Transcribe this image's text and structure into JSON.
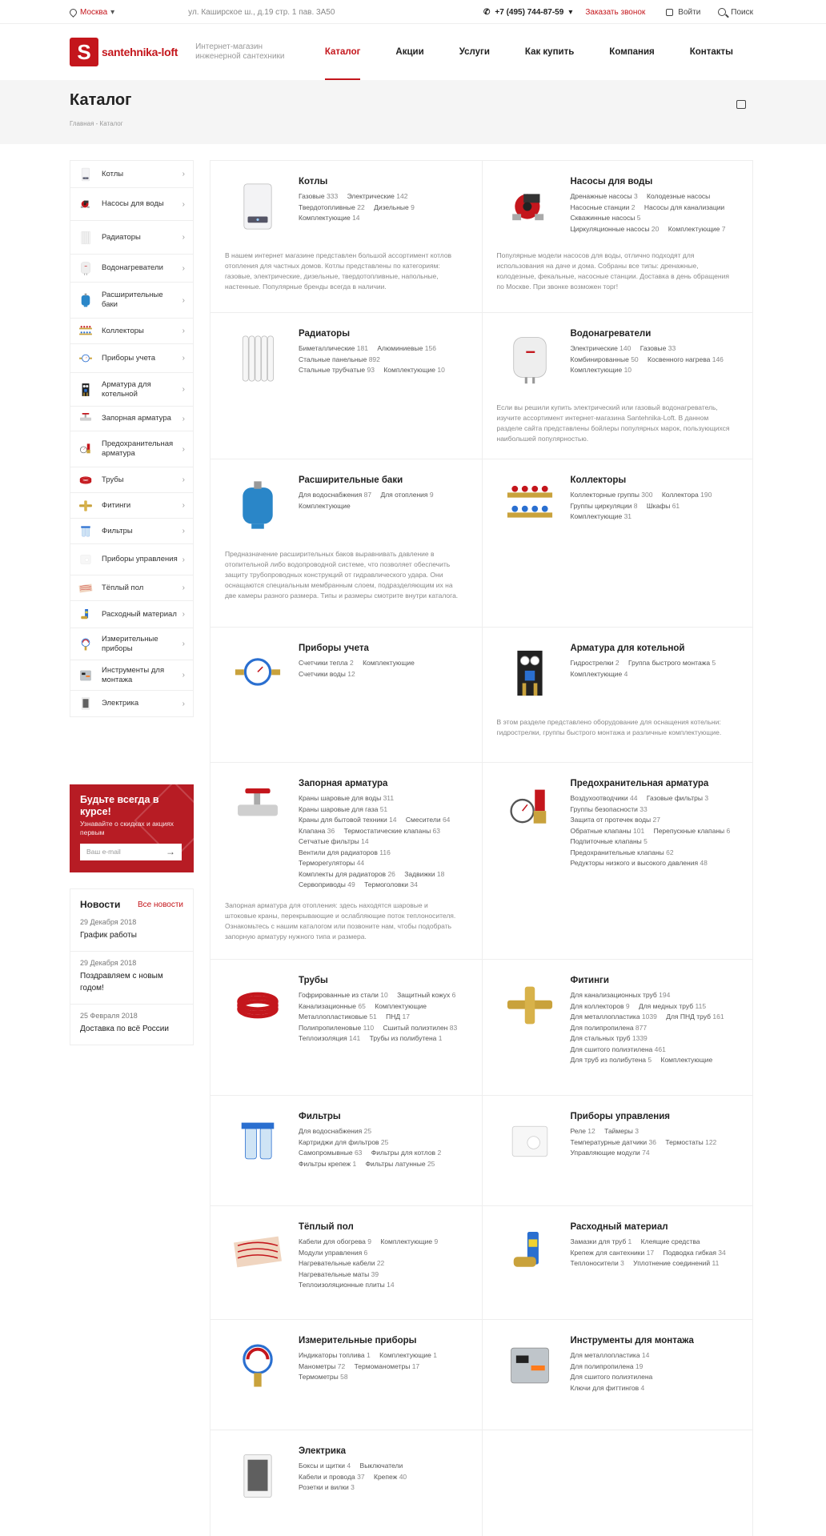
{
  "topbar": {
    "city": "Москва",
    "address": "ул. Каширское ш., д.19 стр. 1 пав. 3А50",
    "phone": "+7 (495) 744-87-59",
    "callback": "Заказать звонок",
    "login": "Войти",
    "search": "Поиск"
  },
  "header": {
    "logo_letter": "S",
    "logo_text": "santehnika-loft",
    "tagline": "Интернет-магазин инженерной сантехники",
    "nav": [
      "Каталог",
      "Акции",
      "Услуги",
      "Как купить",
      "Компания",
      "Контакты"
    ]
  },
  "page": {
    "title": "Каталог",
    "breadcrumb": "Главная - Каталог"
  },
  "sidebar": [
    {
      "label": "Котлы",
      "icon": "boiler-icon"
    },
    {
      "label": "Насосы для воды",
      "icon": "pump-icon"
    },
    {
      "label": "Радиаторы",
      "icon": "radiator-icon"
    },
    {
      "label": "Водонагреватели",
      "icon": "water-heater-icon"
    },
    {
      "label": "Расширительные баки",
      "icon": "expansion-tank-icon"
    },
    {
      "label": "Коллекторы",
      "icon": "manifold-icon"
    },
    {
      "label": "Приборы учета",
      "icon": "water-meter-icon"
    },
    {
      "label": "Арматура для котельной",
      "icon": "boiler-fitting-icon"
    },
    {
      "label": "Запорная арматура",
      "icon": "valve-icon"
    },
    {
      "label": "Предохранительная арматура",
      "icon": "safety-valve-icon"
    },
    {
      "label": "Трубы",
      "icon": "pipe-icon"
    },
    {
      "label": "Фитинги",
      "icon": "fitting-icon"
    },
    {
      "label": "Фильтры",
      "icon": "filter-icon"
    },
    {
      "label": "Приборы управления",
      "icon": "thermostat-icon"
    },
    {
      "label": "Тёплый пол",
      "icon": "floor-heating-icon"
    },
    {
      "label": "Расходный материал",
      "icon": "consumables-icon"
    },
    {
      "label": "Измерительные приборы",
      "icon": "gauge-icon"
    },
    {
      "label": "Инструменты для монтажа",
      "icon": "toolkit-icon"
    },
    {
      "label": "Электрика",
      "icon": "electrical-box-icon"
    }
  ],
  "subscribe": {
    "title": "Будьте всегда в курсе!",
    "text": "Узнавайте о скидках и акциях первым",
    "placeholder": "Ваш e-mail"
  },
  "news": {
    "title": "Новости",
    "all": "Все новости",
    "items": [
      {
        "date": "29 Декабря 2018",
        "title": "График работы"
      },
      {
        "date": "29 Декабря 2018",
        "title": "Поздравляем с новым годом!"
      },
      {
        "date": "25 Февраля 2018",
        "title": "Доставка по всё России"
      }
    ]
  },
  "catalog": [
    {
      "title": "Котлы",
      "icon": "boiler-icon",
      "subs": [
        [
          "Газовые",
          "333"
        ],
        [
          "Электрические",
          "142"
        ],
        [
          "Твердотопливные",
          "22"
        ],
        [
          "Дизельные",
          "9"
        ],
        [
          "Комплектующие",
          "14"
        ]
      ],
      "desc": "В нашем интернет магазине представлен большой ассортимент котлов отопления для частных домов. Котлы представлены по категориям: газовые, электрические, дизельные, твердотопливные, напольные, настенные. Популярные бренды всегда в наличии."
    },
    {
      "title": "Насосы для воды",
      "icon": "pump-icon",
      "subs": [
        [
          "Дренажные насосы",
          "3"
        ],
        [
          "Колодезные насосы",
          ""
        ],
        [
          "Насосные станции",
          "2"
        ],
        [
          "Насосы для канализации",
          ""
        ],
        [
          "Скважинные насосы",
          "5"
        ],
        [
          "Циркуляционные насосы",
          "20"
        ],
        [
          "Комплектующие",
          "7"
        ]
      ],
      "desc": "Популярные модели насосов для воды, отлично подходят для использования на даче и дома. Собраны все типы: дренажные, колодезные, фекальные, насосные станции. Доставка в день обращения по Москве. При звонке возможен торг!"
    },
    {
      "title": "Радиаторы",
      "icon": "radiator-icon",
      "subs": [
        [
          "Биметаллические",
          "181"
        ],
        [
          "Алюминиевые",
          "156"
        ],
        [
          "Стальные панельные",
          "892"
        ],
        [
          "Стальные трубчатые",
          "93"
        ],
        [
          "Комплектующие",
          "10"
        ]
      ],
      "desc": ""
    },
    {
      "title": "Водонагреватели",
      "icon": "water-heater-icon",
      "subs": [
        [
          "Электрические",
          "140"
        ],
        [
          "Газовые",
          "33"
        ],
        [
          "Комбинированные",
          "50"
        ],
        [
          "Косвенного нагрева",
          "146"
        ],
        [
          "Комплектующие",
          "10"
        ]
      ],
      "desc": "Если вы решили купить электрический или газовый водонагреватель, изучите ассортимент интернет-магазина Santehnika-Loft. В данном разделе сайта представлены бойлеры популярных марок, пользующихся наибольшей популярностью."
    },
    {
      "title": "Расширительные баки",
      "icon": "expansion-tank-icon",
      "subs": [
        [
          "Для водоснабжения",
          "87"
        ],
        [
          "Для отопления",
          "9"
        ],
        [
          "Комплектующие",
          ""
        ]
      ],
      "desc": "Предназначение расширительных баков выравнивать давление в отопительной либо водопроводной системе, что позволяет обеспечить защиту трубопроводных конструкций от гидравлического удара. Они оснащаются специальным мембранным слоем, подразделяющим их на две камеры разного размера. Типы и размеры смотрите внутри каталога."
    },
    {
      "title": "Коллекторы",
      "icon": "manifold-icon",
      "subs": [
        [
          "Коллекторные группы",
          "300"
        ],
        [
          "Коллектора",
          "190"
        ],
        [
          "Группы циркуляции",
          "8"
        ],
        [
          "Шкафы",
          "61"
        ],
        [
          "Комплектующие",
          "31"
        ]
      ],
      "desc": ""
    },
    {
      "title": "Приборы учета",
      "icon": "water-meter-icon",
      "subs": [
        [
          "Счетчики тепла",
          "2"
        ],
        [
          "Комплектующие",
          ""
        ],
        [
          "Счетчики воды",
          "12"
        ]
      ],
      "desc": ""
    },
    {
      "title": "Арматура для котельной",
      "icon": "boiler-fitting-icon",
      "subs": [
        [
          "Гидрострелки",
          "2"
        ],
        [
          "Группа быстрого монтажа",
          "5"
        ],
        [
          "Комплектующие",
          "4"
        ]
      ],
      "desc": "В этом разделе представлено оборудование для оснащения котельни: гидрострелки, группы быстрого монтажа и различные комплектующие."
    },
    {
      "title": "Запорная арматура",
      "icon": "valve-icon",
      "subs": [
        [
          "Краны шаровые для воды",
          "311"
        ],
        [
          "Краны шаровые для газа",
          "51"
        ],
        [
          "Краны для бытовой техники",
          "14"
        ],
        [
          "Смесители",
          "64"
        ],
        [
          "Клапана",
          "36"
        ],
        [
          "Термостатические клапаны",
          "63"
        ],
        [
          "Сетчатые фильтры",
          "14"
        ],
        [
          "Вентили для радиаторов",
          "116"
        ],
        [
          "Терморегуляторы",
          "44"
        ],
        [
          "Комплекты для радиаторов",
          "26"
        ],
        [
          "Задвижки",
          "18"
        ],
        [
          "Сервоприводы",
          "49"
        ],
        [
          "Термоголовки",
          "34"
        ]
      ],
      "desc": "Запорная арматура для отопления: здесь находятся шаровые и штоковые краны, перекрывающие и ослабляющие поток теплоносителя. Ознакомьтесь с нашим каталогом или позвоните нам, чтобы подобрать запорную арматуру нужного типа и размера."
    },
    {
      "title": "Предохранительная арматура",
      "icon": "safety-valve-icon",
      "subs": [
        [
          "Воздухоотводчики",
          "44"
        ],
        [
          "Газовые фильтры",
          "3"
        ],
        [
          "Группы безопасности",
          "33"
        ],
        [
          "Защита от протечек воды",
          "27"
        ],
        [
          "Обратные клапаны",
          "101"
        ],
        [
          "Перепускные клапаны",
          "6"
        ],
        [
          "Подпиточные клапаны",
          "5"
        ],
        [
          "Предохранительные клапаны",
          "62"
        ],
        [
          "Редукторы низкого и высокого давления",
          "48"
        ]
      ],
      "desc": ""
    },
    {
      "title": "Трубы",
      "icon": "pipe-icon",
      "subs": [
        [
          "Гофрированные из стали",
          "10"
        ],
        [
          "Защитный кожух",
          "6"
        ],
        [
          "Канализационные",
          "65"
        ],
        [
          "Комплектующие",
          ""
        ],
        [
          "Металлопластиковые",
          "51"
        ],
        [
          "ПНД",
          "17"
        ],
        [
          "Полипропиленовые",
          "110"
        ],
        [
          "Сшитый полиэтилен",
          "83"
        ],
        [
          "Теплоизоляция",
          "141"
        ],
        [
          "Трубы из полибутена",
          "1"
        ]
      ],
      "desc": ""
    },
    {
      "title": "Фитинги",
      "icon": "fitting-icon",
      "subs": [
        [
          "Для канализационных труб",
          "194"
        ],
        [
          "Для коллекторов",
          "9"
        ],
        [
          "Для медных труб",
          "115"
        ],
        [
          "Для металлопластика",
          "1039"
        ],
        [
          "Для ПНД труб",
          "161"
        ],
        [
          "Для полипропилена",
          "877"
        ],
        [
          "Для стальных труб",
          "1339"
        ],
        [
          "Для сшитого полиэтилена",
          "461"
        ],
        [
          "Для труб из полибутена",
          "5"
        ],
        [
          "Комплектующие",
          ""
        ]
      ],
      "desc": ""
    },
    {
      "title": "Фильтры",
      "icon": "filter-icon",
      "subs": [
        [
          "Для водоснабжения",
          "25"
        ],
        [
          "Картриджи для фильтров",
          "25"
        ],
        [
          "Самопромывные",
          "63"
        ],
        [
          "Фильтры для котлов",
          "2"
        ],
        [
          "Фильтры крепеж",
          "1"
        ],
        [
          "Фильтры латунные",
          "25"
        ]
      ],
      "desc": ""
    },
    {
      "title": "Приборы управления",
      "icon": "thermostat-icon",
      "subs": [
        [
          "Реле",
          "12"
        ],
        [
          "Таймеры",
          "3"
        ],
        [
          "Температурные датчики",
          "36"
        ],
        [
          "Термостаты",
          "122"
        ],
        [
          "Управляющие модули",
          "74"
        ]
      ],
      "desc": ""
    },
    {
      "title": "Тёплый пол",
      "icon": "floor-heating-icon",
      "subs": [
        [
          "Кабели для обогрева",
          "9"
        ],
        [
          "Комплектующие",
          "9"
        ],
        [
          "Модули управления",
          "6"
        ],
        [
          "Нагревательные кабели",
          "22"
        ],
        [
          "Нагревательные маты",
          "39"
        ],
        [
          "Теплоизоляционные плиты",
          "14"
        ]
      ],
      "desc": ""
    },
    {
      "title": "Расходный материал",
      "icon": "consumables-icon",
      "subs": [
        [
          "Замазки для труб",
          "1"
        ],
        [
          "Клеящие средства",
          ""
        ],
        [
          "Крепеж для сантехники",
          "17"
        ],
        [
          "Подводка гибкая",
          "34"
        ],
        [
          "Теплоносители",
          "3"
        ],
        [
          "Уплотнение соединений",
          "11"
        ]
      ],
      "desc": ""
    },
    {
      "title": "Измерительные приборы",
      "icon": "gauge-icon",
      "subs": [
        [
          "Индикаторы топлива",
          "1"
        ],
        [
          "Комплектующие",
          "1"
        ],
        [
          "Манометры",
          "72"
        ],
        [
          "Термоманометры",
          "17"
        ],
        [
          "Термометры",
          "58"
        ]
      ],
      "desc": ""
    },
    {
      "title": "Инструменты для монтажа",
      "icon": "toolkit-icon",
      "subs": [
        [
          "Для металлопластика",
          "14"
        ],
        [
          "Для полипропилена",
          "19"
        ],
        [
          "Для сшитого полиэтилена",
          ""
        ],
        [
          "Ключи для фиттингов",
          "4"
        ]
      ],
      "desc": ""
    },
    {
      "title": "Электрика",
      "icon": "electrical-box-icon",
      "subs": [
        [
          "Боксы и щитки",
          "4"
        ],
        [
          "Выключатели",
          ""
        ],
        [
          "Кабели и провода",
          "37"
        ],
        [
          "Крепеж",
          "40"
        ],
        [
          "Розетки и вилки",
          "3"
        ]
      ],
      "desc": ""
    }
  ],
  "colors": {
    "brand": "#c4161c",
    "subscribe_bg": "#b71c24",
    "band": "#f5f5f5"
  }
}
